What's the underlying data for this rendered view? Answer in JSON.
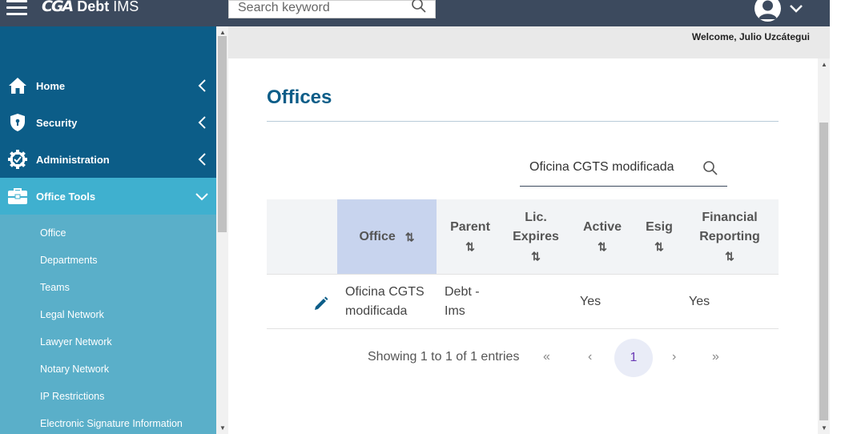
{
  "app": {
    "logo_mark": "CGA",
    "logo_name": "Debt",
    "logo_suffix": "IMS"
  },
  "topbar": {
    "search_placeholder": "Search keyword"
  },
  "welcome": "Welcome, Julio Uzcátegui",
  "sidebar": {
    "items": [
      {
        "label": "Home",
        "icon": "home-icon"
      },
      {
        "label": "Security",
        "icon": "shield-icon"
      },
      {
        "label": "Administration",
        "icon": "gear-icon"
      },
      {
        "label": "Office Tools",
        "icon": "toolbox-icon",
        "active": true
      }
    ],
    "subitems": [
      "Office",
      "Departments",
      "Teams",
      "Legal Network",
      "Lawyer Network",
      "Notary Network",
      "IP Restrictions",
      "Electronic Signature Information"
    ]
  },
  "page": {
    "title": "Offices",
    "search_value": "Oficina CGTS modificada"
  },
  "table": {
    "columns": [
      "Office",
      "Parent",
      "Lic. Expires",
      "Active",
      "Esig",
      "Financial Reporting"
    ],
    "rows": [
      {
        "office": "Oficina CGTS modificada",
        "parent": "Debt - Ims",
        "lic_expires": "",
        "active": "Yes",
        "esig": "",
        "financial_reporting": "Yes"
      }
    ]
  },
  "pagination": {
    "info": "Showing 1 to 1 of 1 entries",
    "first": "«",
    "prev": "‹",
    "current": "1",
    "next": "›",
    "last": "»"
  },
  "colors": {
    "topbar": "#3c4a5e",
    "sidebar": "#0c5d88",
    "active_item": "#3fb0cf",
    "submenu": "#5aafc9",
    "title": "#0c5d88"
  }
}
